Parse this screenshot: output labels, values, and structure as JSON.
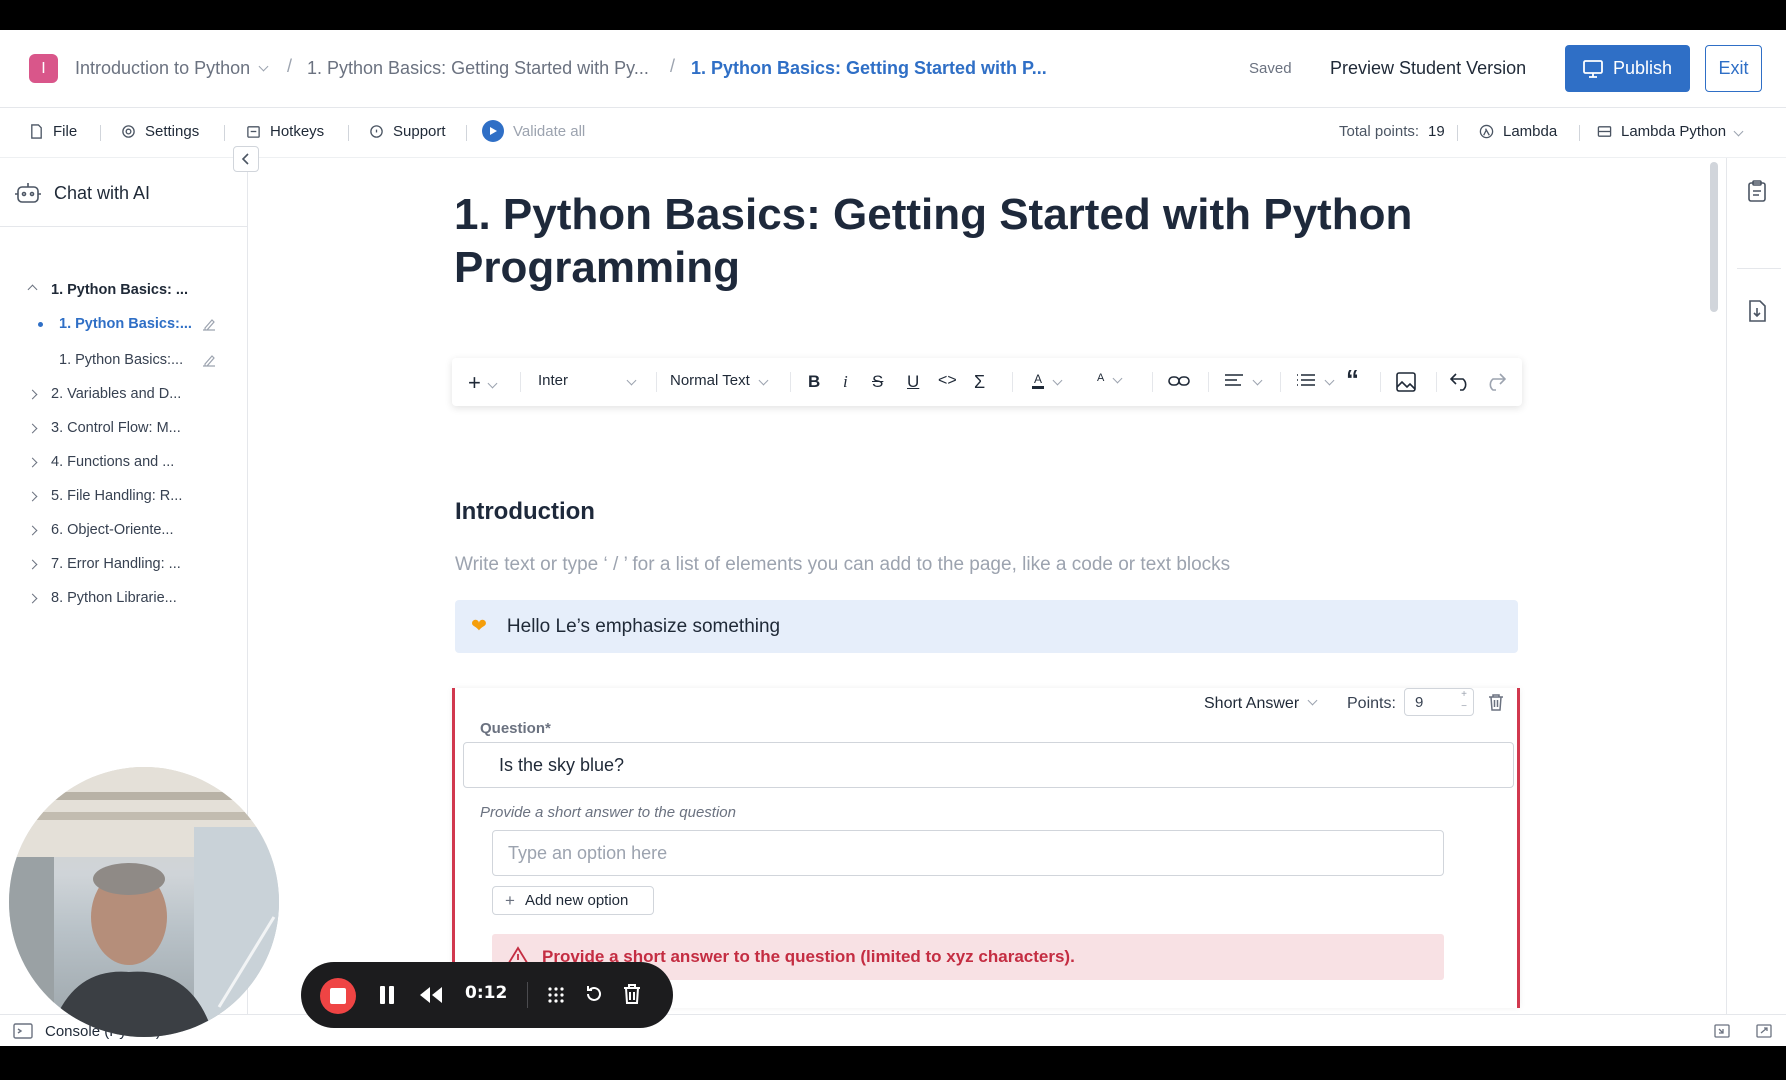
{
  "header": {
    "logo_letter": "I",
    "breadcrumbs": [
      "Introduction to Python",
      "1. Python Basics: Getting Started with Py...",
      "1. Python Basics: Getting Started with P..."
    ],
    "saved": "Saved",
    "preview": "Preview Student Version",
    "publish": "Publish",
    "exit": "Exit"
  },
  "toolbar": {
    "file": "File",
    "settings": "Settings",
    "hotkeys": "Hotkeys",
    "support": "Support",
    "validate": "Validate all",
    "total_points_label": "Total points:",
    "total_points_value": "19",
    "runtime": "Lambda",
    "environment": "Lambda Python"
  },
  "sidebar": {
    "chat": "Chat with AI",
    "items": [
      "1. Python Basics: ...",
      "1. Python Basics:...",
      "1. Python Basics:...",
      "2. Variables and D...",
      "3. Control Flow: M...",
      "4. Functions and ...",
      "5. File Handling: R...",
      "6. Object-Oriente...",
      "7. Error Handling: ...",
      "8. Python Librarie..."
    ]
  },
  "editor": {
    "title": "1. Python Basics: Getting Started with Python Programming",
    "font": "Inter",
    "text_style": "Normal Text",
    "heading": "Introduction",
    "placeholder": "Write text or type ‘ / ’ for a list of elements you can add to the page, like a code or text blocks",
    "callout_emoji": "🧡",
    "callout_text": "Hello Le’s emphasize something"
  },
  "question": {
    "type": "Short Answer",
    "points_label": "Points:",
    "points_value": "9",
    "label": "Question*",
    "text": "Is the sky blue?",
    "hint": "Provide a short answer to the question",
    "option_placeholder": "Type an option here",
    "add_option": "Add new option",
    "warning": "Provide a short answer to the question (limited to xyz characters)."
  },
  "console": {
    "label": "Console (Python)"
  },
  "recorder": {
    "time": "0:12"
  },
  "colors": {
    "accent": "#2f6fc6",
    "error": "#d1384e",
    "callout_bg": "#e6eefa"
  }
}
